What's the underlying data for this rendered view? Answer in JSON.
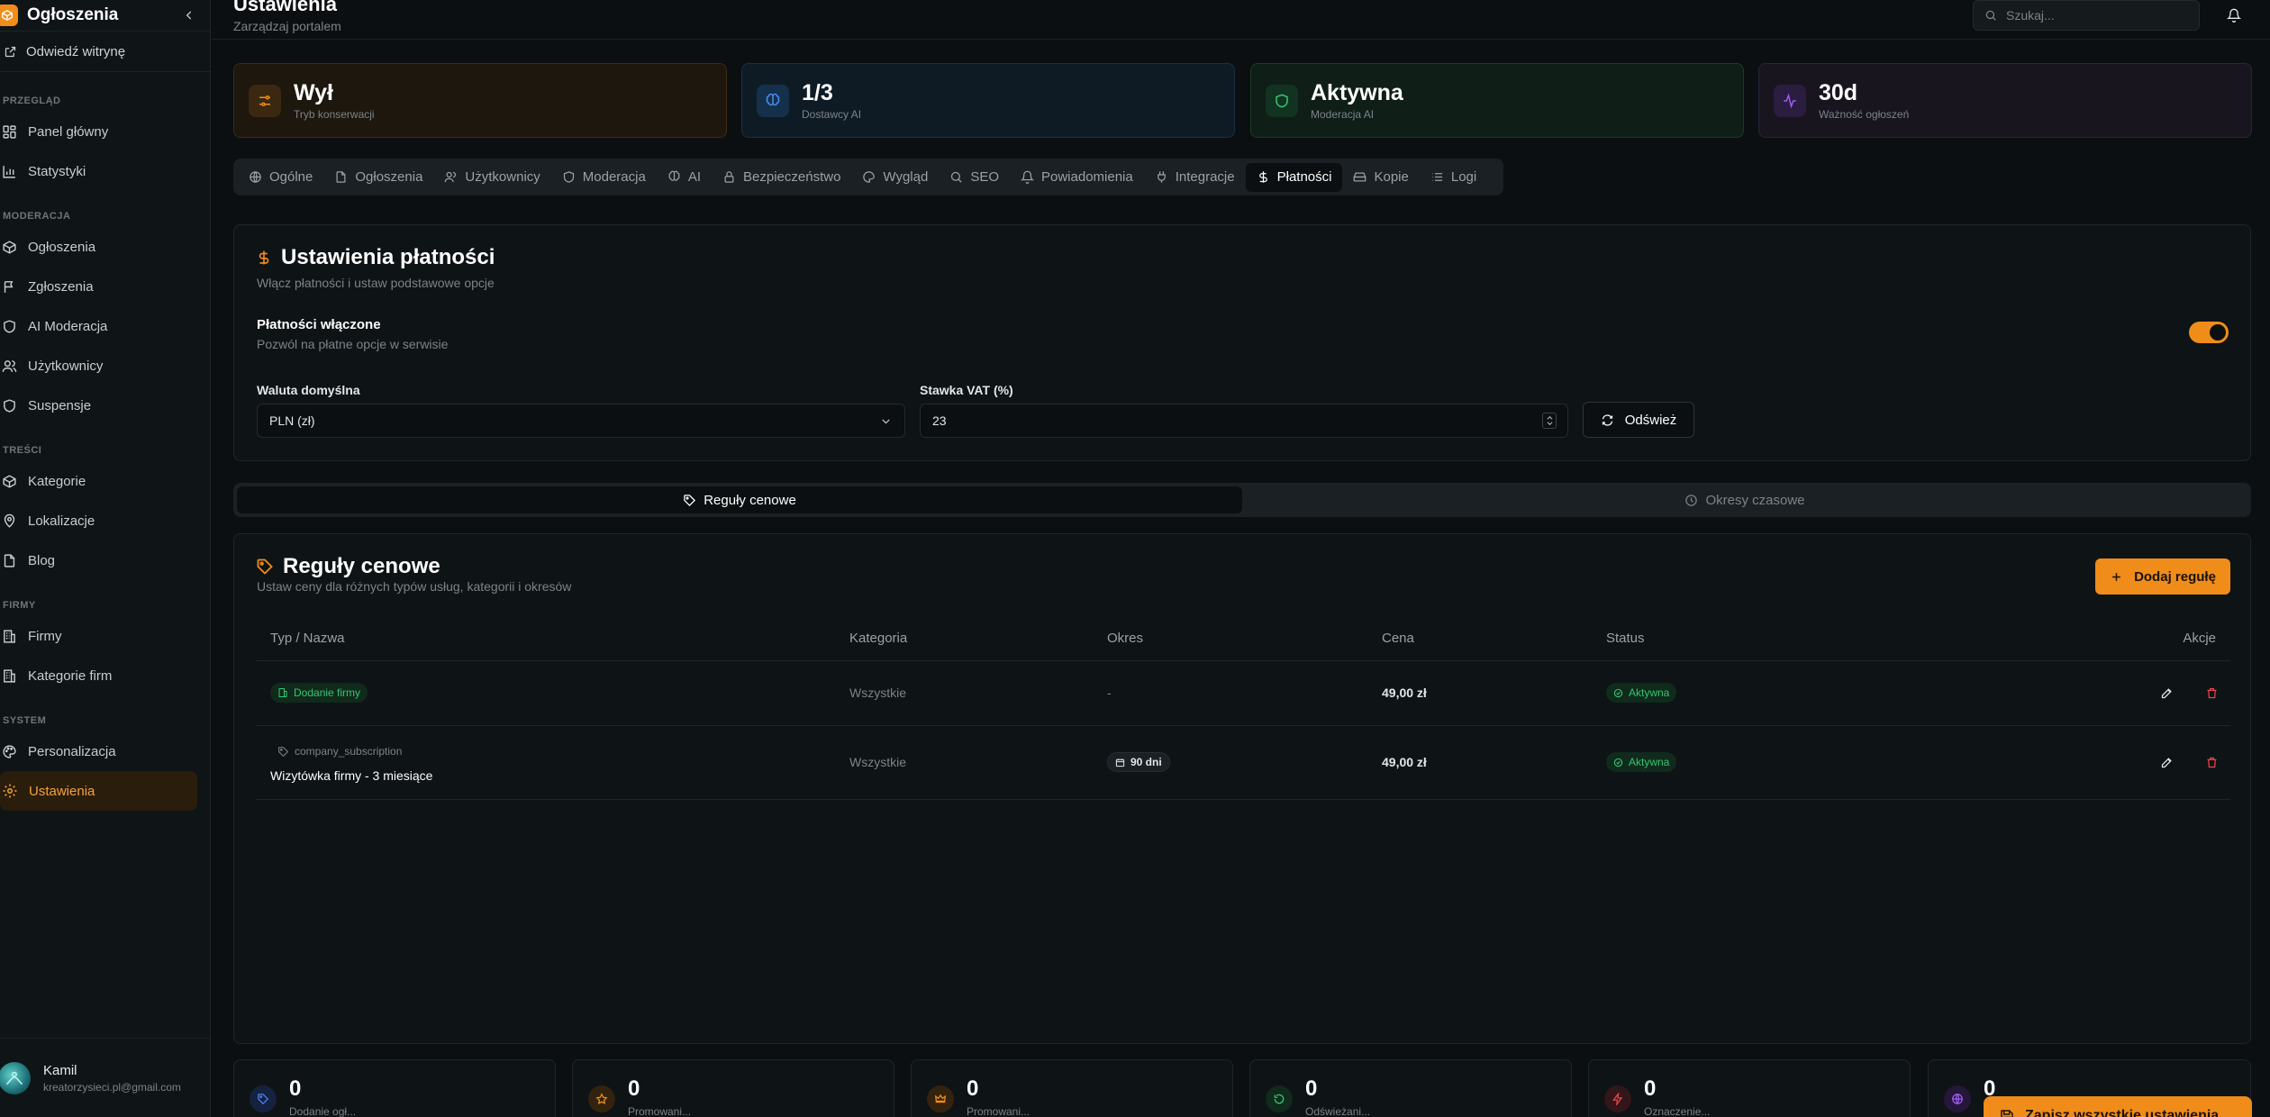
{
  "colors": {
    "accent": "#f08c1a",
    "success": "#34c770",
    "danger": "#e5484d",
    "background": "#0b0f11"
  },
  "sidebar": {
    "brand": "Ogłoszenia",
    "visit_site": "Odwiedź witrynę",
    "sections": [
      {
        "title": "PRZEGLĄD",
        "items": [
          {
            "label": "Panel główny",
            "icon": "dashboard-icon"
          },
          {
            "label": "Statystyki",
            "icon": "bar-chart-icon"
          }
        ]
      },
      {
        "title": "MODERACJA",
        "items": [
          {
            "label": "Ogłoszenia",
            "icon": "package-icon"
          },
          {
            "label": "Zgłoszenia",
            "icon": "flag-icon"
          },
          {
            "label": "AI Moderacja",
            "icon": "shield-icon"
          },
          {
            "label": "Użytkownicy",
            "icon": "users-icon"
          },
          {
            "label": "Suspensje",
            "icon": "shield-icon"
          }
        ]
      },
      {
        "title": "TREŚCI",
        "items": [
          {
            "label": "Kategorie",
            "icon": "package-icon"
          },
          {
            "label": "Lokalizacje",
            "icon": "map-pin-icon"
          },
          {
            "label": "Blog",
            "icon": "file-icon"
          }
        ]
      },
      {
        "title": "FIRMY",
        "items": [
          {
            "label": "Firmy",
            "icon": "building-icon"
          },
          {
            "label": "Kategorie firm",
            "icon": "building-icon"
          }
        ]
      },
      {
        "title": "SYSTEM",
        "items": [
          {
            "label": "Personalizacja",
            "icon": "palette-icon"
          },
          {
            "label": "Ustawienia",
            "icon": "gear-icon",
            "active": true
          }
        ]
      }
    ],
    "user": {
      "name": "Kamil",
      "email": "kreatorzysieci.pl@gmail.com"
    }
  },
  "header": {
    "title": "Ustawienia",
    "subtitle": "Zarządzaj portalem",
    "search_placeholder": "Szukaj..."
  },
  "stats": [
    {
      "value": "Wył",
      "label": "Tryb konserwacji",
      "icon": "sliders-icon"
    },
    {
      "value": "1/3",
      "label": "Dostawcy AI",
      "icon": "brain-icon"
    },
    {
      "value": "Aktywna",
      "label": "Moderacja AI",
      "icon": "shield-icon"
    },
    {
      "value": "30d",
      "label": "Ważność ogłoszeń",
      "icon": "activity-icon"
    }
  ],
  "tabs": [
    {
      "label": "Ogólne",
      "icon": "globe-icon"
    },
    {
      "label": "Ogłoszenia",
      "icon": "file-icon"
    },
    {
      "label": "Użytkownicy",
      "icon": "users-icon"
    },
    {
      "label": "Moderacja",
      "icon": "shield-icon"
    },
    {
      "label": "AI",
      "icon": "brain-icon"
    },
    {
      "label": "Bezpieczeństwo",
      "icon": "lock-icon"
    },
    {
      "label": "Wygląd",
      "icon": "palette-icon"
    },
    {
      "label": "SEO",
      "icon": "search-icon"
    },
    {
      "label": "Powiadomienia",
      "icon": "bell-icon"
    },
    {
      "label": "Integracje",
      "icon": "plug-icon"
    },
    {
      "label": "Płatności",
      "icon": "dollar-icon",
      "active": true
    },
    {
      "label": "Kopie",
      "icon": "hard-drive-icon"
    },
    {
      "label": "Logi",
      "icon": "logs-icon"
    }
  ],
  "payments": {
    "title": "Ustawienia płatności",
    "subtitle": "Włącz płatności i ustaw podstawowe opcje",
    "enabled_label": "Płatności włączone",
    "enabled_desc": "Pozwól na płatne opcje w serwisie",
    "enabled": true,
    "currency_label": "Waluta domyślna",
    "currency_value": "PLN (zł)",
    "vat_label": "Stawka VAT (%)",
    "vat_value": "23",
    "refresh_label": "Odśwież"
  },
  "subtabs": [
    {
      "label": "Reguły cenowe",
      "icon": "tag-icon",
      "active": true
    },
    {
      "label": "Okresy czasowe",
      "icon": "clock-icon"
    }
  ],
  "rules": {
    "title": "Reguły cenowe",
    "subtitle": "Ustaw ceny dla różnych typów usług, kategorii i okresów",
    "add_label": "Dodaj regułę",
    "columns": [
      "Typ / Nazwa",
      "Kategoria",
      "Okres",
      "Cena",
      "Status",
      "Akcje"
    ],
    "rows": [
      {
        "type": "Dodanie firmy",
        "name": "",
        "category": "Wszystkie",
        "period": "-",
        "price": "49,00 zł",
        "status": "Aktywna"
      },
      {
        "type": "company_subscription",
        "name": "Wizytówka firmy - 3 miesiące",
        "category": "Wszystkie",
        "period": "90 dni",
        "price": "49,00 zł",
        "status": "Aktywna"
      }
    ]
  },
  "bottom_stats": [
    {
      "value": "0",
      "label": "Dodanie ogł...",
      "icon": "tag-icon",
      "color": "#4a7cf0"
    },
    {
      "value": "0",
      "label": "Promowani...",
      "icon": "star-icon",
      "color": "#f08c1a"
    },
    {
      "value": "0",
      "label": "Promowani...",
      "icon": "crown-icon",
      "color": "#f08c1a"
    },
    {
      "value": "0",
      "label": "Odświeżani...",
      "icon": "refresh-icon",
      "color": "#34c770"
    },
    {
      "value": "0",
      "label": "Oznaczenie...",
      "icon": "zap-icon",
      "color": "#e5484d"
    },
    {
      "value": "0",
      "label": "",
      "icon": "globe-icon",
      "color": "#a05cf0"
    }
  ],
  "save_all_label": "Zapisz wszystkie ustawienia"
}
